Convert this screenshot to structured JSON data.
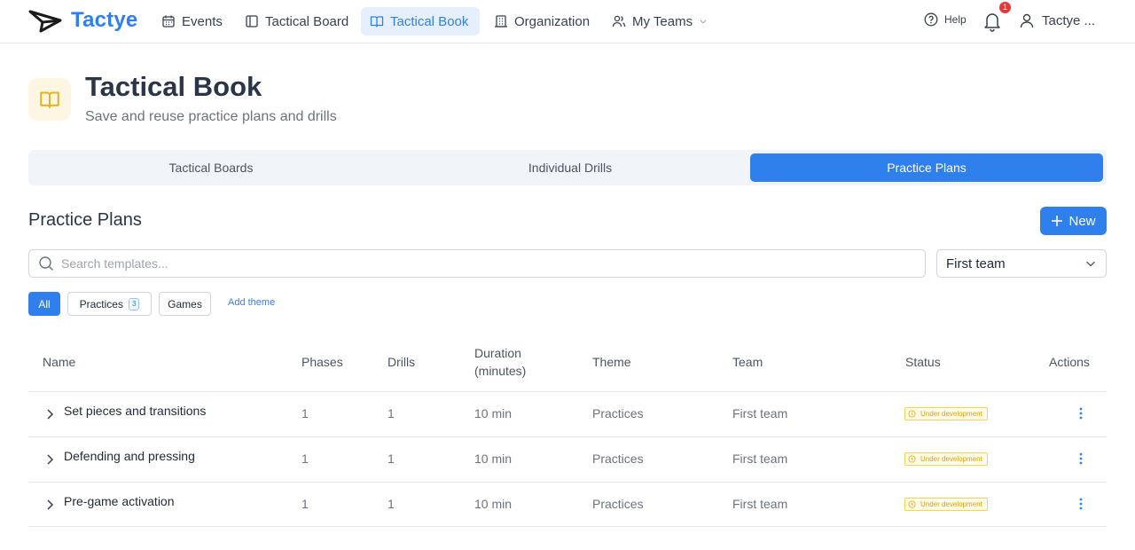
{
  "brand": {
    "name": "Tactye",
    "accent": "#2f80ed"
  },
  "nav": {
    "items": [
      {
        "label": "Events",
        "icon": "calendar-icon"
      },
      {
        "label": "Tactical Board",
        "icon": "board-icon"
      },
      {
        "label": "Tactical Book",
        "icon": "book-icon",
        "active": true
      },
      {
        "label": "Organization",
        "icon": "building-icon"
      },
      {
        "label": "My Teams",
        "icon": "users-icon"
      }
    ],
    "help": "Help",
    "notifications": "1",
    "user": "Tactye ..."
  },
  "header": {
    "title": "Tactical Book",
    "subtitle": "Save and reuse practice plans and drills"
  },
  "tabs": [
    {
      "label": "Tactical Boards"
    },
    {
      "label": "Individual Drills"
    },
    {
      "label": "Practice Plans",
      "active": true
    }
  ],
  "section": {
    "title": "Practice Plans",
    "new_label": "New"
  },
  "search": {
    "placeholder": "Search templates...",
    "value": ""
  },
  "team_select": {
    "value": "First team"
  },
  "filters": {
    "all": "All",
    "practices": "Practices",
    "practices_count": "3",
    "games": "Games",
    "add_theme": "Add theme"
  },
  "table": {
    "headers": {
      "name": "Name",
      "phases": "Phases",
      "drills": "Drills",
      "duration_line1": "Duration",
      "duration_line2": "(minutes)",
      "theme": "Theme",
      "team": "Team",
      "status": "Status",
      "actions": "Actions"
    },
    "rows": [
      {
        "name": "Set pieces and transitions",
        "phases": "1",
        "drills": "1",
        "duration": "10 min",
        "theme": "Practices",
        "team": "First team",
        "status": "Under development"
      },
      {
        "name": "Defending and pressing",
        "phases": "1",
        "drills": "1",
        "duration": "10 min",
        "theme": "Practices",
        "team": "First team",
        "status": "Under development"
      },
      {
        "name": "Pre-game activation",
        "phases": "1",
        "drills": "1",
        "duration": "10 min",
        "theme": "Practices",
        "team": "First team",
        "status": "Under development"
      }
    ]
  }
}
